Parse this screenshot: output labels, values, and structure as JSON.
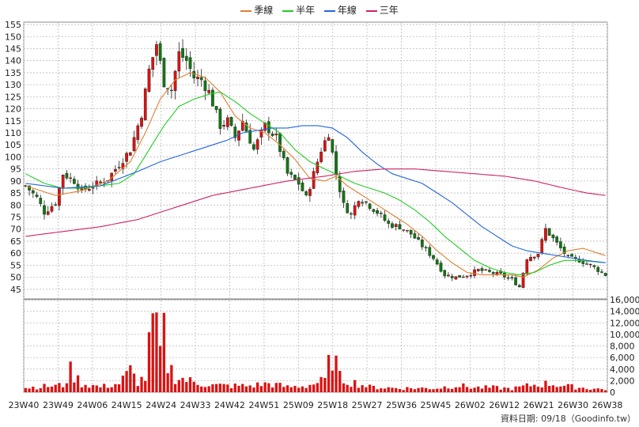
{
  "chart_data": {
    "type": "candlestick",
    "legend": [
      {
        "name": "季線",
        "color": "#e08030"
      },
      {
        "name": "半年",
        "color": "#22cc22"
      },
      {
        "name": "年線",
        "color": "#2266dd"
      },
      {
        "name": "三年",
        "color": "#cc2266"
      }
    ],
    "price_axis": {
      "ticks": [
        45,
        50,
        55,
        60,
        65,
        70,
        75,
        80,
        85,
        90,
        95,
        100,
        105,
        110,
        115,
        120,
        125,
        130,
        135,
        140,
        145,
        150,
        155
      ],
      "ylim": [
        41,
        156
      ]
    },
    "volume_axis": {
      "ticks": [
        "0",
        "2,000",
        "4,000",
        "6,000",
        "8,000",
        "10,000",
        "12,000",
        "14,000",
        "16,000"
      ],
      "ylim": [
        0,
        16000
      ]
    },
    "x_labels": [
      "23W40",
      "23W49",
      "24W06",
      "24W15",
      "24W24",
      "24W33",
      "24W42",
      "24W51",
      "25W09",
      "25W18",
      "25W27",
      "25W36",
      "25W45",
      "26W02",
      "26W12",
      "26W21",
      "26W30",
      "26W38"
    ],
    "weeks": 156,
    "price_keypoints": [
      [
        0,
        88
      ],
      [
        3,
        83
      ],
      [
        5,
        77
      ],
      [
        8,
        81
      ],
      [
        10,
        93
      ],
      [
        13,
        90
      ],
      [
        15,
        86
      ],
      [
        18,
        88
      ],
      [
        22,
        91
      ],
      [
        25,
        97
      ],
      [
        28,
        103
      ],
      [
        31,
        118
      ],
      [
        33,
        136
      ],
      [
        35,
        147
      ],
      [
        37,
        131
      ],
      [
        39,
        128
      ],
      [
        41,
        143
      ],
      [
        43,
        140
      ],
      [
        45,
        133
      ],
      [
        47,
        132
      ],
      [
        49,
        127
      ],
      [
        52,
        113
      ],
      [
        54,
        115
      ],
      [
        56,
        108
      ],
      [
        58,
        115
      ],
      [
        61,
        103
      ],
      [
        64,
        113
      ],
      [
        67,
        108
      ],
      [
        70,
        93
      ],
      [
        73,
        89
      ],
      [
        75,
        83
      ],
      [
        77,
        93
      ],
      [
        79,
        103
      ],
      [
        81,
        110
      ],
      [
        83,
        93
      ],
      [
        85,
        80
      ],
      [
        87,
        76
      ],
      [
        89,
        83
      ],
      [
        91,
        81
      ],
      [
        94,
        77
      ],
      [
        97,
        72
      ],
      [
        100,
        71
      ],
      [
        103,
        68
      ],
      [
        106,
        63
      ],
      [
        109,
        58
      ],
      [
        112,
        51
      ],
      [
        115,
        50
      ],
      [
        118,
        51
      ],
      [
        121,
        53
      ],
      [
        124,
        52
      ],
      [
        127,
        51
      ],
      [
        130,
        49
      ],
      [
        132,
        46
      ],
      [
        134,
        58
      ],
      [
        137,
        60
      ],
      [
        139,
        70
      ],
      [
        141,
        66
      ],
      [
        143,
        62
      ],
      [
        145,
        58
      ],
      [
        148,
        57
      ],
      [
        151,
        55
      ],
      [
        155,
        51
      ]
    ],
    "volume_keypoints": [
      [
        0,
        800
      ],
      [
        10,
        1200
      ],
      [
        12,
        3600
      ],
      [
        15,
        1500
      ],
      [
        20,
        900
      ],
      [
        25,
        1500
      ],
      [
        28,
        3600
      ],
      [
        30,
        1800
      ],
      [
        32,
        2500
      ],
      [
        34,
        12000
      ],
      [
        36,
        6800
      ],
      [
        37,
        9600
      ],
      [
        38,
        4800
      ],
      [
        40,
        2700
      ],
      [
        45,
        1700
      ],
      [
        50,
        1200
      ],
      [
        55,
        1100
      ],
      [
        60,
        1100
      ],
      [
        65,
        1500
      ],
      [
        70,
        900
      ],
      [
        75,
        1100
      ],
      [
        80,
        2000
      ],
      [
        82,
        7000
      ],
      [
        84,
        2500
      ],
      [
        87,
        1800
      ],
      [
        92,
        900
      ],
      [
        100,
        700
      ],
      [
        110,
        700
      ],
      [
        115,
        1200
      ],
      [
        120,
        800
      ],
      [
        125,
        800
      ],
      [
        130,
        600
      ],
      [
        135,
        1200
      ],
      [
        140,
        1500
      ],
      [
        145,
        1000
      ],
      [
        150,
        700
      ],
      [
        155,
        500
      ]
    ],
    "ma_keypoints": {
      "季線": [
        [
          0,
          88
        ],
        [
          8,
          84
        ],
        [
          15,
          86
        ],
        [
          22,
          90
        ],
        [
          28,
          98
        ],
        [
          32,
          110
        ],
        [
          36,
          124
        ],
        [
          40,
          132
        ],
        [
          44,
          135
        ],
        [
          48,
          133
        ],
        [
          52,
          127
        ],
        [
          56,
          117
        ],
        [
          60,
          112
        ],
        [
          64,
          110
        ],
        [
          68,
          105
        ],
        [
          72,
          99
        ],
        [
          76,
          91
        ],
        [
          80,
          90
        ],
        [
          83,
          92
        ],
        [
          86,
          88
        ],
        [
          90,
          84
        ],
        [
          94,
          80
        ],
        [
          98,
          76
        ],
        [
          102,
          72
        ],
        [
          106,
          67
        ],
        [
          110,
          61
        ],
        [
          114,
          56
        ],
        [
          118,
          52
        ],
        [
          122,
          51
        ],
        [
          126,
          51
        ],
        [
          130,
          51
        ],
        [
          133,
          50
        ],
        [
          137,
          53
        ],
        [
          141,
          58
        ],
        [
          145,
          61
        ],
        [
          149,
          62
        ],
        [
          155,
          59
        ]
      ],
      "半年": [
        [
          0,
          93
        ],
        [
          5,
          89
        ],
        [
          10,
          87
        ],
        [
          15,
          87
        ],
        [
          20,
          88
        ],
        [
          25,
          89
        ],
        [
          29,
          93
        ],
        [
          33,
          103
        ],
        [
          37,
          113
        ],
        [
          41,
          121
        ],
        [
          45,
          124
        ],
        [
          49,
          126
        ],
        [
          52,
          127
        ],
        [
          56,
          123
        ],
        [
          60,
          118
        ],
        [
          64,
          114
        ],
        [
          68,
          110
        ],
        [
          72,
          103
        ],
        [
          76,
          98
        ],
        [
          80,
          95
        ],
        [
          84,
          92
        ],
        [
          88,
          89
        ],
        [
          92,
          87
        ],
        [
          96,
          85
        ],
        [
          100,
          82
        ],
        [
          104,
          78
        ],
        [
          108,
          73
        ],
        [
          112,
          67
        ],
        [
          116,
          62
        ],
        [
          120,
          57
        ],
        [
          124,
          54
        ],
        [
          128,
          52
        ],
        [
          132,
          51
        ],
        [
          136,
          52
        ],
        [
          140,
          55
        ],
        [
          144,
          57
        ],
        [
          148,
          57
        ],
        [
          155,
          56
        ]
      ],
      "年線": [
        [
          0,
          89
        ],
        [
          10,
          87
        ],
        [
          20,
          88
        ],
        [
          30,
          94
        ],
        [
          36,
          98
        ],
        [
          42,
          101
        ],
        [
          48,
          104
        ],
        [
          54,
          107
        ],
        [
          58,
          110
        ],
        [
          62,
          111
        ],
        [
          66,
          112
        ],
        [
          70,
          112
        ],
        [
          74,
          113
        ],
        [
          78,
          113
        ],
        [
          82,
          112
        ],
        [
          86,
          108
        ],
        [
          90,
          102
        ],
        [
          94,
          97
        ],
        [
          98,
          93
        ],
        [
          102,
          91
        ],
        [
          106,
          89
        ],
        [
          110,
          85
        ],
        [
          114,
          81
        ],
        [
          118,
          76
        ],
        [
          122,
          71
        ],
        [
          126,
          67
        ],
        [
          130,
          63
        ],
        [
          134,
          61
        ],
        [
          138,
          60
        ],
        [
          142,
          59
        ],
        [
          146,
          58
        ],
        [
          150,
          57
        ],
        [
          155,
          56
        ]
      ],
      "三年": [
        [
          0,
          67
        ],
        [
          10,
          69
        ],
        [
          20,
          71
        ],
        [
          30,
          74
        ],
        [
          40,
          79
        ],
        [
          50,
          84
        ],
        [
          60,
          87
        ],
        [
          70,
          90
        ],
        [
          80,
          92
        ],
        [
          88,
          94
        ],
        [
          96,
          95
        ],
        [
          104,
          95
        ],
        [
          112,
          94
        ],
        [
          120,
          93
        ],
        [
          128,
          92
        ],
        [
          136,
          90
        ],
        [
          144,
          87
        ],
        [
          150,
          85
        ],
        [
          155,
          84
        ]
      ]
    }
  },
  "source": "資料日期: 09/18（Goodinfo.tw）"
}
